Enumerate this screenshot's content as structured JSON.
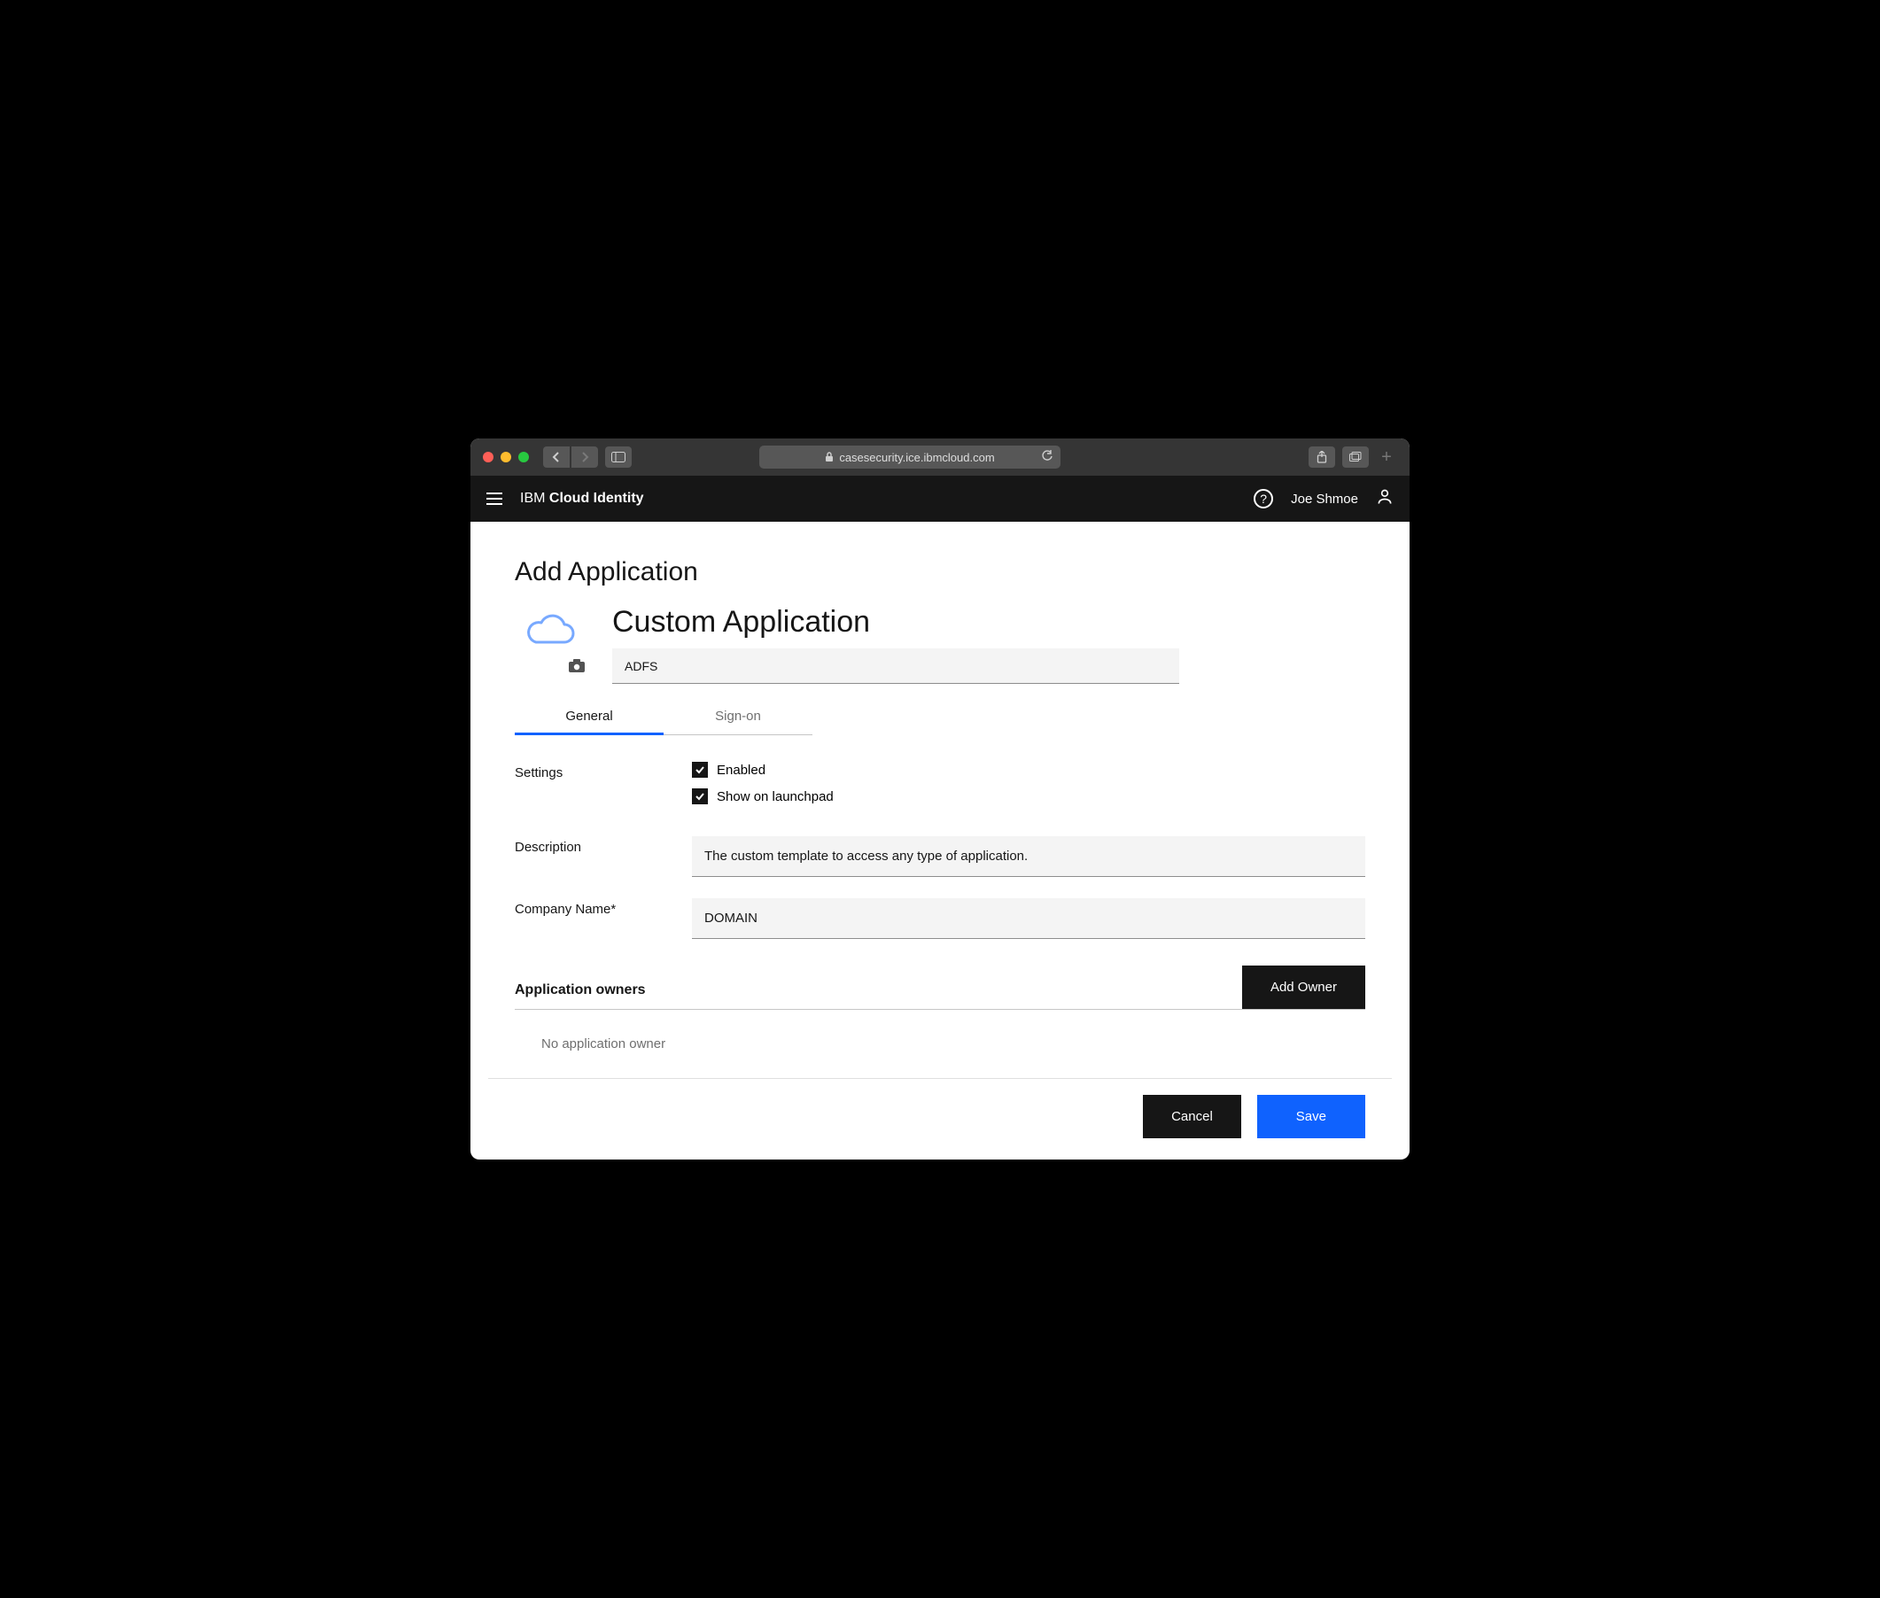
{
  "browser": {
    "url": "casesecurity.ice.ibmcloud.com"
  },
  "header": {
    "brand_prefix": "IBM ",
    "brand_bold": "Cloud Identity",
    "user_name": "Joe Shmoe"
  },
  "page": {
    "title": "Add Application",
    "app_heading": "Custom Application",
    "app_name_value": "ADFS"
  },
  "tabs": [
    {
      "label": "General",
      "active": true
    },
    {
      "label": "Sign-on",
      "active": false
    }
  ],
  "settings": {
    "label": "Settings",
    "enabled": {
      "label": "Enabled",
      "checked": true
    },
    "launchpad": {
      "label": "Show on launchpad",
      "checked": true
    }
  },
  "description": {
    "label": "Description",
    "value": "The custom template to access any type of application."
  },
  "company": {
    "label": "Company Name*",
    "value": "DOMAIN"
  },
  "owners": {
    "title": "Application owners",
    "add_button": "Add Owner",
    "empty_text": "No application owner"
  },
  "footer": {
    "cancel": "Cancel",
    "save": "Save"
  }
}
